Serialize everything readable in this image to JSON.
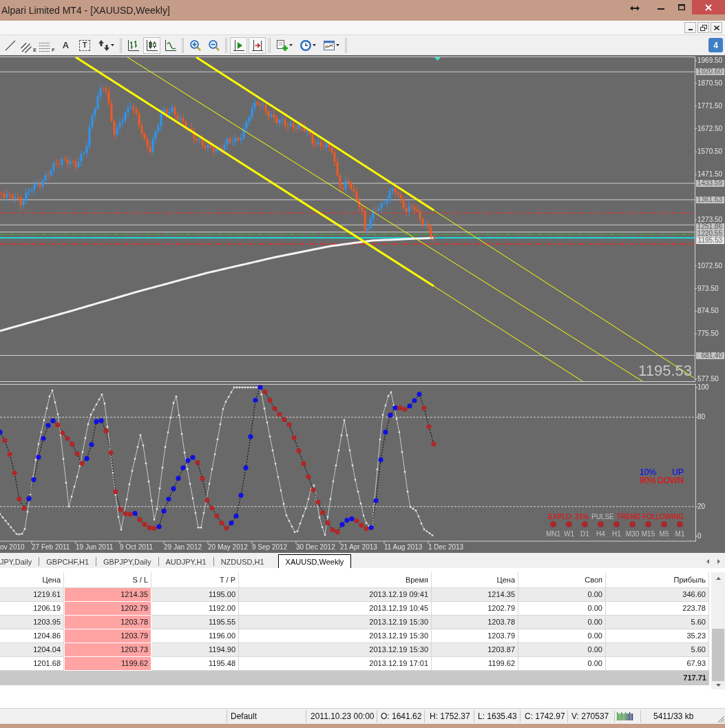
{
  "window": {
    "title": "Alpari Limited MT4 - [XAUUSD,Weekly]"
  },
  "toolbar": {
    "groups": [
      [
        {
          "kind": "line",
          "pressed": false
        },
        {
          "kind": "fibo-channel",
          "glyph": "E",
          "pressed": false
        },
        {
          "kind": "fibo",
          "glyph": "F",
          "pressed": false
        },
        {
          "kind": "text",
          "glyph": "A",
          "pressed": false
        },
        {
          "kind": "label",
          "glyph": "T",
          "pressed": false
        },
        {
          "kind": "arrows",
          "pressed": false
        }
      ],
      [
        {
          "kind": "bars",
          "pressed": false
        },
        {
          "kind": "candles",
          "pressed": true
        },
        {
          "kind": "line-chart",
          "pressed": false
        }
      ],
      [
        {
          "kind": "zoom-in",
          "pressed": false
        },
        {
          "kind": "zoom-out",
          "pressed": false
        }
      ],
      [
        {
          "kind": "chart-shift",
          "pressed": true
        },
        {
          "kind": "auto-scroll",
          "pressed": true
        }
      ],
      [
        {
          "kind": "indicators",
          "pressed": false
        },
        {
          "kind": "periods",
          "pressed": false
        },
        {
          "kind": "templates",
          "pressed": false
        }
      ]
    ]
  },
  "notifications": {
    "count": "4"
  },
  "chart": {
    "price_ticks": [
      "1969.50",
      "1870.50",
      "1771.50",
      "1672.50",
      "1570.50",
      "1471.50",
      "1273.50",
      "1072.50",
      "973.50",
      "874.50",
      "775.50",
      "577.50"
    ],
    "price_markers": [
      {
        "label": "1920.60",
        "kind": "level"
      },
      {
        "label": "1433.59",
        "kind": "level"
      },
      {
        "label": "1361.63",
        "kind": "level"
      },
      {
        "label": "1251.86",
        "kind": "level"
      },
      {
        "label": "1220.55",
        "kind": "level"
      },
      {
        "label": "1195.53",
        "kind": "bid"
      },
      {
        "label": "681.40",
        "kind": "level"
      }
    ],
    "last_price": "1195.53",
    "date_labels": [
      "ov 2010",
      "27 Feb 2011",
      "19 Jun 2011",
      "9 Oct 2011",
      "29 Jan 2012",
      "20 May 2012",
      "9 Sep 2012",
      "30 Dec 2012",
      "21 Apr 2013",
      "11 Aug 2013",
      "1 Dec 2013"
    ]
  },
  "indicator": {
    "levels": [
      "100",
      "80",
      "20",
      "0"
    ],
    "direction": [
      {
        "percent": "10%",
        "label": "UP",
        "color": "#0000ff"
      },
      {
        "percent": "90%",
        "label": "DOWN",
        "color": "#ff0000"
      }
    ],
    "status": [
      {
        "text": "EXPLO: 31%",
        "color": "#ff0000"
      },
      {
        "text": "PULSE",
        "color": "#c0c0c0"
      },
      {
        "text": "TREND FOLLOWING",
        "color": "#ff0000"
      }
    ],
    "timeframes": [
      {
        "label": "MN1",
        "color": "#a52a2a"
      },
      {
        "label": "W1",
        "color": "#a52a2a"
      },
      {
        "label": "D1",
        "color": "#a52a2a"
      },
      {
        "label": "H4",
        "color": "#a52a2a"
      },
      {
        "label": "H1",
        "color": "#a52a2a"
      },
      {
        "label": "M30",
        "color": "#a52a2a"
      },
      {
        "label": "M15",
        "color": "#a52a2a"
      },
      {
        "label": "M5",
        "color": "#a52a2a"
      },
      {
        "label": "M1",
        "color": "#a52a2a"
      }
    ]
  },
  "chart_tabs": [
    {
      "label": "JPY,Daily",
      "selected": false
    },
    {
      "label": "GBPCHF,H1",
      "selected": false
    },
    {
      "label": "GBPJPY,Daily",
      "selected": false
    },
    {
      "label": "AUDJPY,H1",
      "selected": false
    },
    {
      "label": "NZDUSD,H1",
      "selected": false
    },
    {
      "label": "XAUUSD,Weekly",
      "selected": true
    }
  ],
  "trades": {
    "columns": [
      {
        "label": "Цена",
        "highlighted": false
      },
      {
        "label": "S / L",
        "highlighted": true
      },
      {
        "label": "T / P",
        "highlighted": false
      },
      {
        "label": "Время",
        "highlighted": false
      },
      {
        "label": "Цена",
        "highlighted": false
      },
      {
        "label": "Своп",
        "highlighted": false
      },
      {
        "label": "Прибыль",
        "highlighted": false
      }
    ],
    "rows": [
      [
        "1219.61",
        "1214.35",
        "1195.00",
        "2013.12.19 09:41",
        "1214.35",
        "0.00",
        "346.60"
      ],
      [
        "1206.19",
        "1202.79",
        "1192.00",
        "2013.12.19 10:45",
        "1202.79",
        "0.00",
        "223.78"
      ],
      [
        "1203.95",
        "1203.78",
        "1195.55",
        "2013.12.19 15:30",
        "1203.78",
        "0.00",
        "5.60"
      ],
      [
        "1204.86",
        "1203.79",
        "1196.00",
        "2013.12.19 15:30",
        "1203.79",
        "0.00",
        "35.23"
      ],
      [
        "1204.04",
        "1203.73",
        "1194.90",
        "2013.12.19 15:30",
        "1203.87",
        "0.00",
        "5.60"
      ],
      [
        "1201.68",
        "1199.62",
        "1195.48",
        "2013.12.19 17:01",
        "1199.62",
        "0.00",
        "67.93"
      ]
    ],
    "total": "717.71"
  },
  "status_bar": {
    "profile": "Default",
    "time": "2011.10.23 00:00",
    "open": "O: 1641.62",
    "high": "H: 1752.37",
    "low": "L: 1635.43",
    "close": "C: 1742.97",
    "volume": "V: 270537",
    "traffic": "5411/33 kb"
  }
}
